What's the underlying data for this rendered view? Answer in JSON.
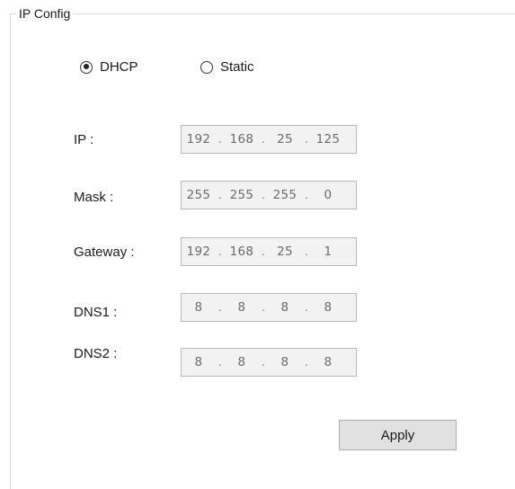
{
  "group_title": "IP Config",
  "mode": {
    "options": [
      {
        "label": "DHCP",
        "selected": true
      },
      {
        "label": "Static",
        "selected": false
      }
    ]
  },
  "fields": [
    {
      "label": "IP :",
      "octets": [
        "192",
        "168",
        "25",
        "125"
      ]
    },
    {
      "label": "Mask :",
      "octets": [
        "255",
        "255",
        "255",
        "0"
      ]
    },
    {
      "label": "Gateway :",
      "octets": [
        "192",
        "168",
        "25",
        "1"
      ]
    },
    {
      "label": "DNS1 :",
      "octets": [
        "8",
        "8",
        "8",
        "8"
      ]
    },
    {
      "label": "DNS2 :",
      "octets": [
        "8",
        "8",
        "8",
        "8"
      ]
    }
  ],
  "separator": ".",
  "apply_label": "Apply"
}
